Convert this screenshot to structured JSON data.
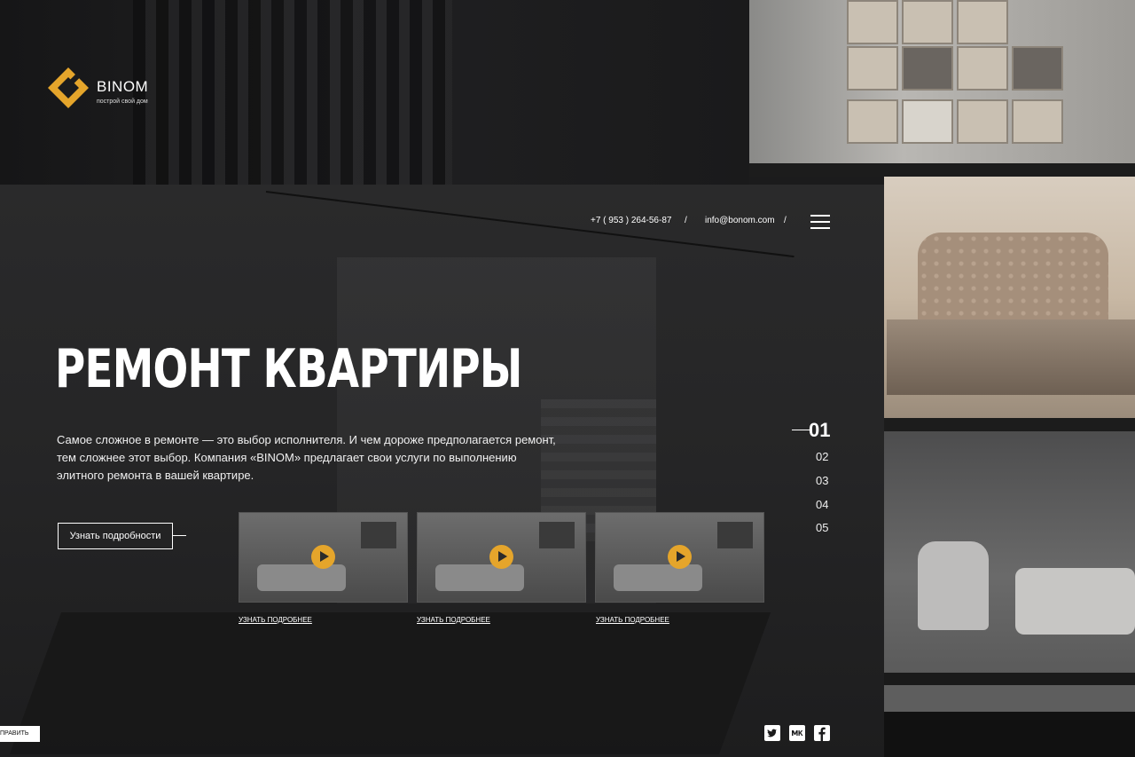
{
  "brand": {
    "name": "BINOM",
    "tagline": "построй свой дом",
    "accent": "#e5a52b"
  },
  "header": {
    "phone": "+7 ( 953 ) 264-56-87",
    "separator": "/",
    "email": "info@bonom.com",
    "menu_icon": "hamburger-icon"
  },
  "hero": {
    "title": "РЕМОНТ КВАРТИРЫ",
    "description": "Самое сложное в ремонте — это выбор исполнителя. И чем дороже предполагается ремонт, тем сложнее этот выбор. Компания «BINOM» предлагает свои услуги по выполнению элитного ремонта в вашей квартире.",
    "cta_label": "Узнать подробности"
  },
  "videos": [
    {
      "link_label": "УЗНАТЬ ПОДРОБНЕЕ",
      "icon": "play-icon"
    },
    {
      "link_label": "УЗНАТЬ ПОДРОБНЕЕ",
      "icon": "play-icon"
    },
    {
      "link_label": "УЗНАТЬ ПОДРОБНЕЕ",
      "icon": "play-icon"
    }
  ],
  "pagination": {
    "active": "01",
    "items": [
      "02",
      "03",
      "04",
      "05"
    ]
  },
  "social": [
    "twitter-icon",
    "vk-icon",
    "facebook-icon"
  ],
  "edit_button": {
    "label": "ПРАВИТЬ"
  }
}
